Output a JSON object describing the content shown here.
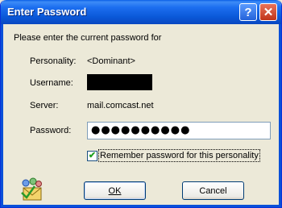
{
  "window": {
    "title": "Enter Password",
    "help_glyph": "?",
    "close_glyph": "✕"
  },
  "dialog": {
    "prompt": "Please enter the current password for",
    "personality_label": "Personality:",
    "personality_value": "<Dominant>",
    "username_label": "Username:",
    "username_value_redacted": true,
    "server_label": "Server:",
    "server_value": "mail.comcast.net",
    "password_label": "Password:",
    "password_value": "●●●●●●●●●●",
    "remember_label": "Remember password for this personality",
    "remember_checked": true,
    "check_glyph": "✔"
  },
  "buttons": {
    "ok": "OK",
    "cancel": "Cancel"
  },
  "icons": {
    "app": "eudora-mail-icon",
    "help": "help-icon",
    "close": "close-icon",
    "check": "check-icon"
  },
  "colors": {
    "titlebar": "#0a58d8",
    "dialog_bg": "#ece9d8",
    "close_button": "#c0341a"
  }
}
